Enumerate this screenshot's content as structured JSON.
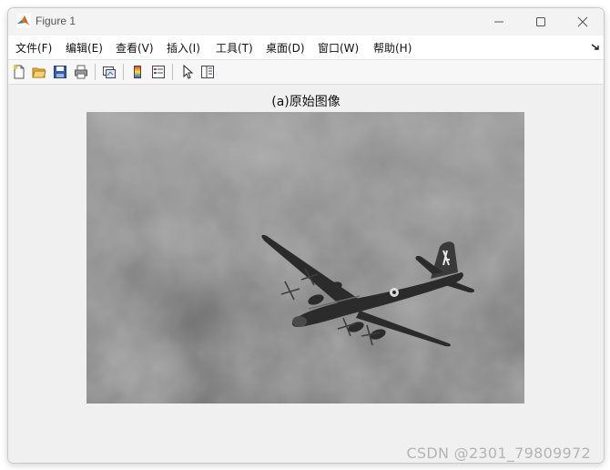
{
  "window": {
    "title": "Figure 1"
  },
  "menubar": {
    "items": [
      {
        "label": "文件(F)"
      },
      {
        "label": "编辑(E)"
      },
      {
        "label": "查看(V)"
      },
      {
        "label": "插入(I)"
      },
      {
        "label": "工具(T)"
      },
      {
        "label": "桌面(D)"
      },
      {
        "label": "窗口(W)"
      },
      {
        "label": "帮助(H)"
      }
    ]
  },
  "toolbar": {
    "buttons": [
      {
        "icon": "new-figure-icon"
      },
      {
        "icon": "open-folder-icon"
      },
      {
        "icon": "save-icon"
      },
      {
        "icon": "print-icon"
      },
      {
        "icon": "link-plot-icon"
      },
      {
        "icon": "colorbar-icon"
      },
      {
        "icon": "legend-icon"
      },
      {
        "icon": "pointer-icon"
      },
      {
        "icon": "property-editor-icon"
      }
    ]
  },
  "figure": {
    "axes_title": "(a)原始图像",
    "image_tone": "grayscale",
    "image_subject": "airplane"
  },
  "watermark": "CSDN @2301_79809972",
  "colors": {
    "window_bg": "#f0f0f0",
    "matlab_orange": "#e8741a"
  }
}
